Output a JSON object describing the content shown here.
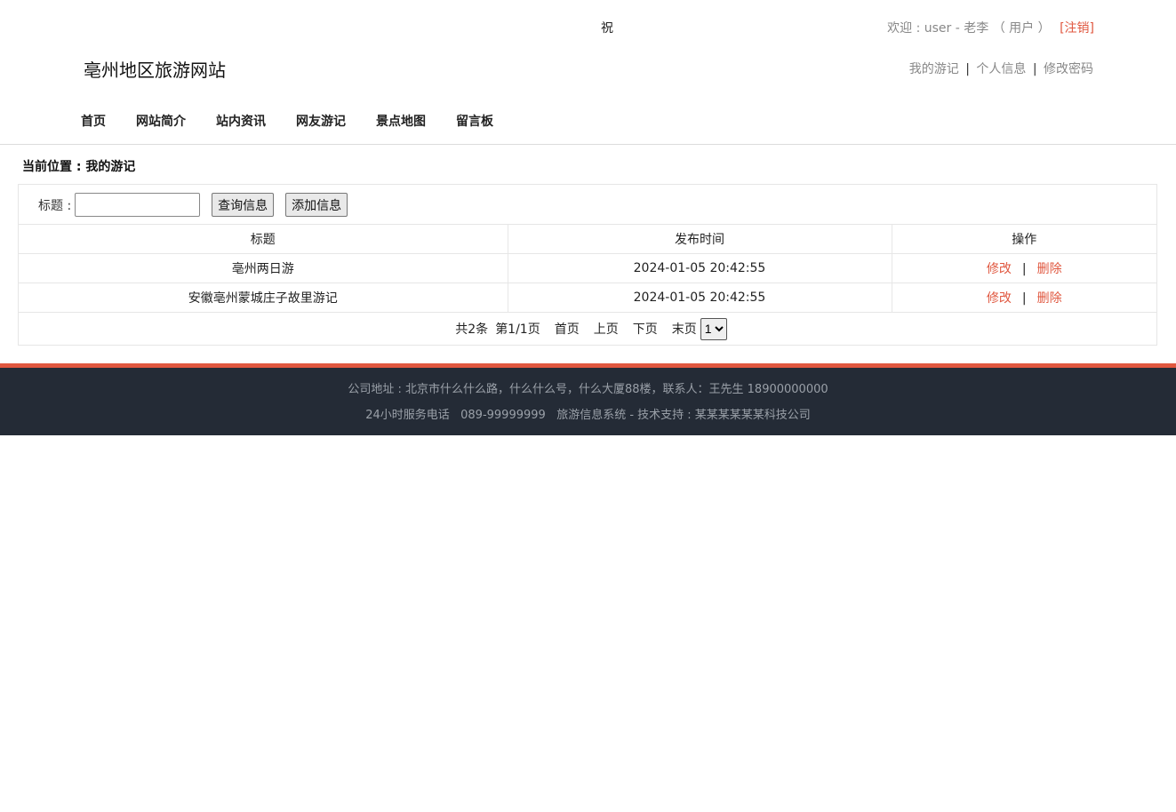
{
  "header": {
    "greeting": "祝",
    "welcome_text": "欢迎 : user - 老李 （ 用户 ）",
    "logout_label": "[注销]",
    "site_title": "亳州地区旅游网站",
    "user_links": [
      "我的游记",
      "个人信息",
      "修改密码"
    ],
    "link_separator": "|"
  },
  "nav": {
    "items": [
      "首页",
      "网站简介",
      "站内资讯",
      "网友游记",
      "景点地图",
      "留言板"
    ]
  },
  "breadcrumb": "当前位置 : 我的游记",
  "search": {
    "label": "标题 :",
    "value": "",
    "query_button": "查询信息",
    "add_button": "添加信息"
  },
  "table": {
    "columns": [
      "标题",
      "发布时间",
      "操作"
    ],
    "rows": [
      {
        "title": "亳州两日游",
        "time": "2024-01-05 20:42:55"
      },
      {
        "title": "安徽亳州蒙城庄子故里游记",
        "time": "2024-01-05 20:42:55"
      }
    ],
    "edit_label": "修改",
    "delete_label": "删除",
    "action_separator": "|"
  },
  "pager": {
    "total": "共2条",
    "page_info": "第1/1页",
    "first": "首页",
    "prev": "上页",
    "next": "下页",
    "last": "末页",
    "selected_page": "1"
  },
  "footer": {
    "line1": "公司地址 : 北京市什么什么路，什么什么号，什么大厦88楼，联系人：王先生 18900000000",
    "line2": "24小时服务电话   089-99999999   旅游信息系统 - 技术支持 : 某某某某某某科技公司"
  },
  "colors": {
    "accent": "#e0573f",
    "footer_bg": "#242b36"
  }
}
